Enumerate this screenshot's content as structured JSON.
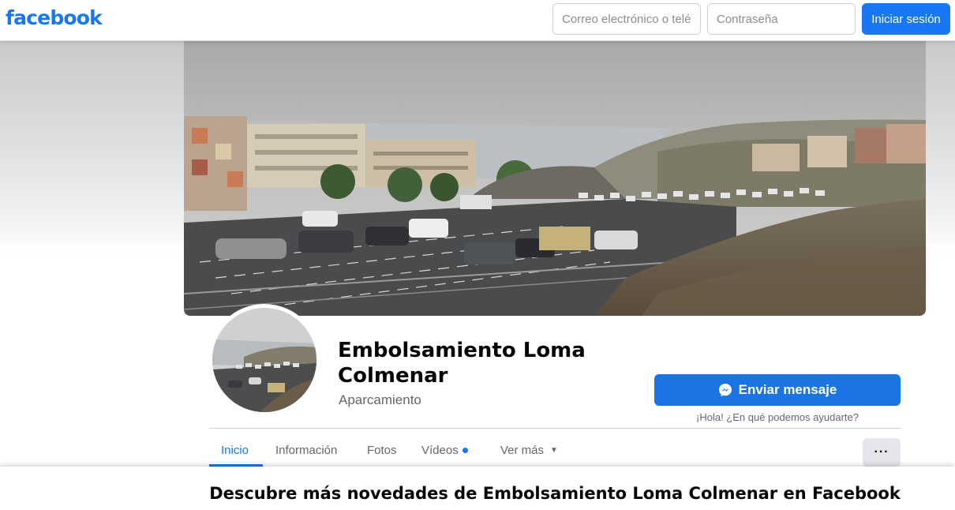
{
  "header": {
    "logo": "facebook",
    "email_placeholder": "Correo electrónico o teléfono",
    "password_placeholder": "Contraseña",
    "login_label": "Iniciar sesión"
  },
  "profile": {
    "name": "Embolsamiento Loma Colmenar",
    "category": "Aparcamiento"
  },
  "actions": {
    "message_label": "Enviar mensaje",
    "message_icon": "messenger-icon",
    "message_hint": "¡Hola! ¿En qué podemos ayudarte?"
  },
  "tabs": [
    {
      "label": "Inicio",
      "active": true
    },
    {
      "label": "Información"
    },
    {
      "label": "Fotos"
    },
    {
      "label": "Vídeos"
    },
    {
      "label": "Ver más"
    }
  ],
  "more_label": "···",
  "banner": {
    "text": "Descubre más novedades de Embolsamiento Loma Colmenar en Facebook"
  },
  "colors": {
    "brand": "#1877f2",
    "button": "#1b74e4",
    "text_secondary": "#65676b"
  }
}
